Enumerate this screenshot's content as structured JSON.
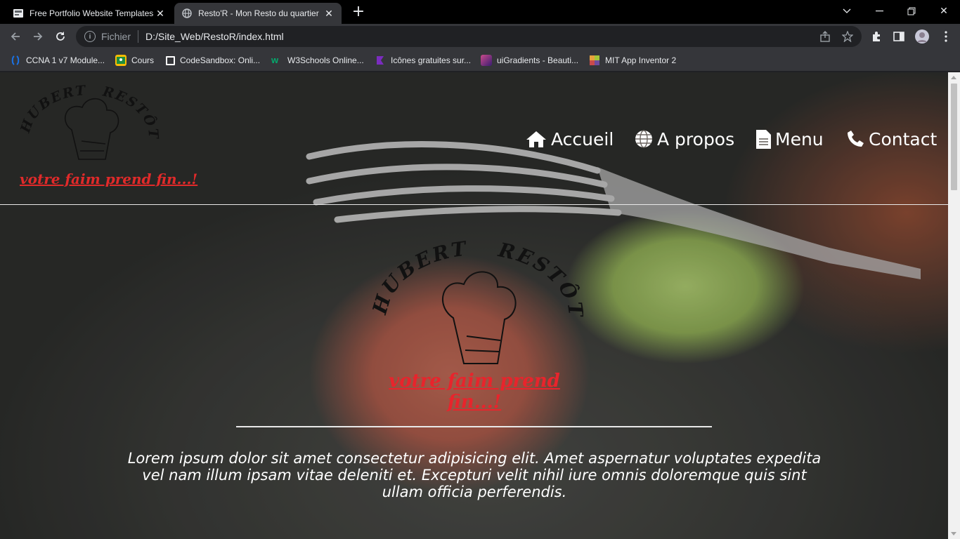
{
  "browser": {
    "tabs": [
      {
        "title": "Free Portfolio Website Templates",
        "active": false,
        "icon": "document-icon"
      },
      {
        "title": "Resto'R - Mon Resto du quartier",
        "active": true,
        "icon": "globe-icon"
      }
    ],
    "address": {
      "scheme_label": "Fichier",
      "url": "D:/Site_Web/RestoR/index.html"
    },
    "bookmarks": [
      {
        "label": "CCNA 1 v7 Module...",
        "color": "#1a73e8"
      },
      {
        "label": "Cours",
        "color": "#fbbc04"
      },
      {
        "label": "CodeSandbox: Onli...",
        "color": "#ffffff"
      },
      {
        "label": "W3Schools Online...",
        "color": "#04aa6d"
      },
      {
        "label": "Icônes gratuites sur...",
        "color": "#7b2cbf"
      },
      {
        "label": "uiGradients - Beauti...",
        "color": "#c94b8b"
      },
      {
        "label": "MIT App Inventor 2",
        "color": "#e8a33d"
      }
    ]
  },
  "site": {
    "logo": {
      "line1": "HUBERT",
      "line2": "RESTÔT",
      "tagline": "votre faim prend fin...!"
    },
    "nav": [
      {
        "label": "Accueil",
        "icon": "home-icon"
      },
      {
        "label": "A propos",
        "icon": "globe-icon"
      },
      {
        "label": "Menu",
        "icon": "file-icon"
      },
      {
        "label": "Contact",
        "icon": "phone-icon"
      }
    ],
    "hero": {
      "text": "Lorem ipsum dolor sit amet consectetur adipisicing elit. Amet aspernatur voluptates expedita vel nam illum ipsam vitae deleniti et. Excepturi velit nihil iure omnis doloremque quis sint ullam officia perferendis."
    },
    "colors": {
      "accent": "#e8242c",
      "nav_text": "#ffffff"
    }
  }
}
